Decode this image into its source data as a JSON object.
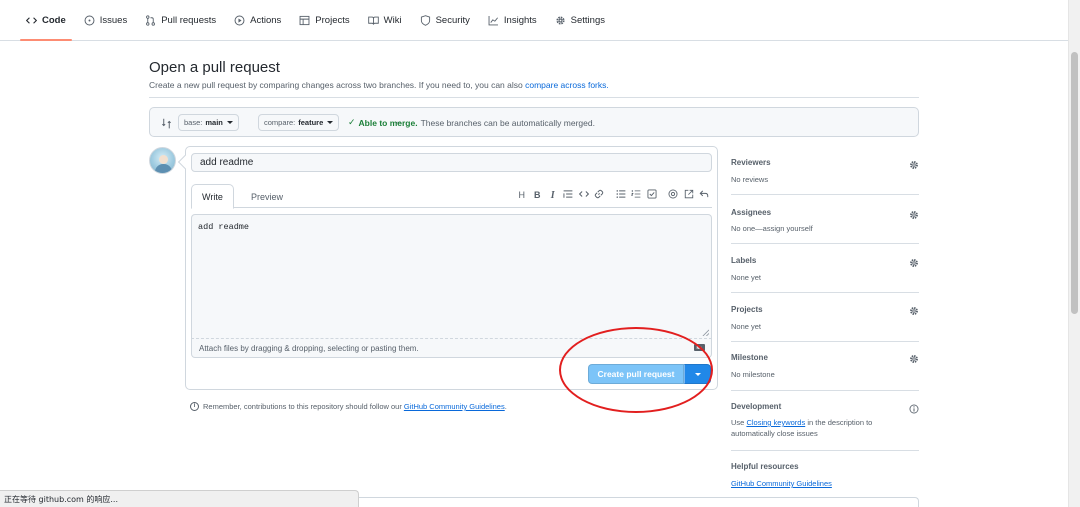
{
  "nav": {
    "items": [
      {
        "label": "Code",
        "icon": "code-icon"
      },
      {
        "label": "Issues",
        "icon": "issue-icon"
      },
      {
        "label": "Pull requests",
        "icon": "pull-request-icon"
      },
      {
        "label": "Actions",
        "icon": "play-icon"
      },
      {
        "label": "Projects",
        "icon": "table-icon"
      },
      {
        "label": "Wiki",
        "icon": "book-icon"
      },
      {
        "label": "Security",
        "icon": "shield-icon"
      },
      {
        "label": "Insights",
        "icon": "graph-icon"
      },
      {
        "label": "Settings",
        "icon": "gear-icon"
      }
    ]
  },
  "header": {
    "title": "Open a pull request",
    "subtitle": "Create a new pull request by comparing changes across two branches. If you need to, you can also",
    "subtitle_link": "compare across forks."
  },
  "range": {
    "base_prefix": "base:",
    "base_branch": "main",
    "compare_prefix": "compare:",
    "compare_branch": "feature",
    "merge_status": "Able to merge.",
    "merge_message": "These branches can be automatically merged."
  },
  "composer": {
    "title_value": "add readme",
    "tab_write": "Write",
    "tab_preview": "Preview",
    "body_value": "add readme",
    "attach_hint": "Attach files by dragging & dropping, selecting or pasting them.",
    "markdown_badge": "M↓",
    "submit_label": "Create pull request"
  },
  "toolbar": {
    "heading": "H",
    "bold": "B",
    "italic": "I"
  },
  "reminder": {
    "text": "Remember, contributions to this repository should follow our",
    "link": "GitHub Community Guidelines",
    "end": "."
  },
  "sidebar": {
    "reviewers": {
      "title": "Reviewers",
      "value": "No reviews"
    },
    "assignees": {
      "title": "Assignees",
      "value": "No one—assign yourself"
    },
    "labels": {
      "title": "Labels",
      "value": "None yet"
    },
    "projects": {
      "title": "Projects",
      "value": "None yet"
    },
    "milestone": {
      "title": "Milestone",
      "value": "No milestone"
    },
    "development": {
      "title": "Development",
      "value_pre": "Use",
      "value_link": "Closing keywords",
      "value_post": "in the description to automatically close issues"
    },
    "help": {
      "title": "Helpful resources",
      "link": "GitHub Community Guidelines"
    }
  },
  "status_bar": {
    "text": "正在等待 github.com 的响应..."
  },
  "colors": {
    "accent": "#0969da",
    "merge_ok": "#1a7f37",
    "annotation": "#e21f1f",
    "nav_underline": "#fd8c73"
  }
}
